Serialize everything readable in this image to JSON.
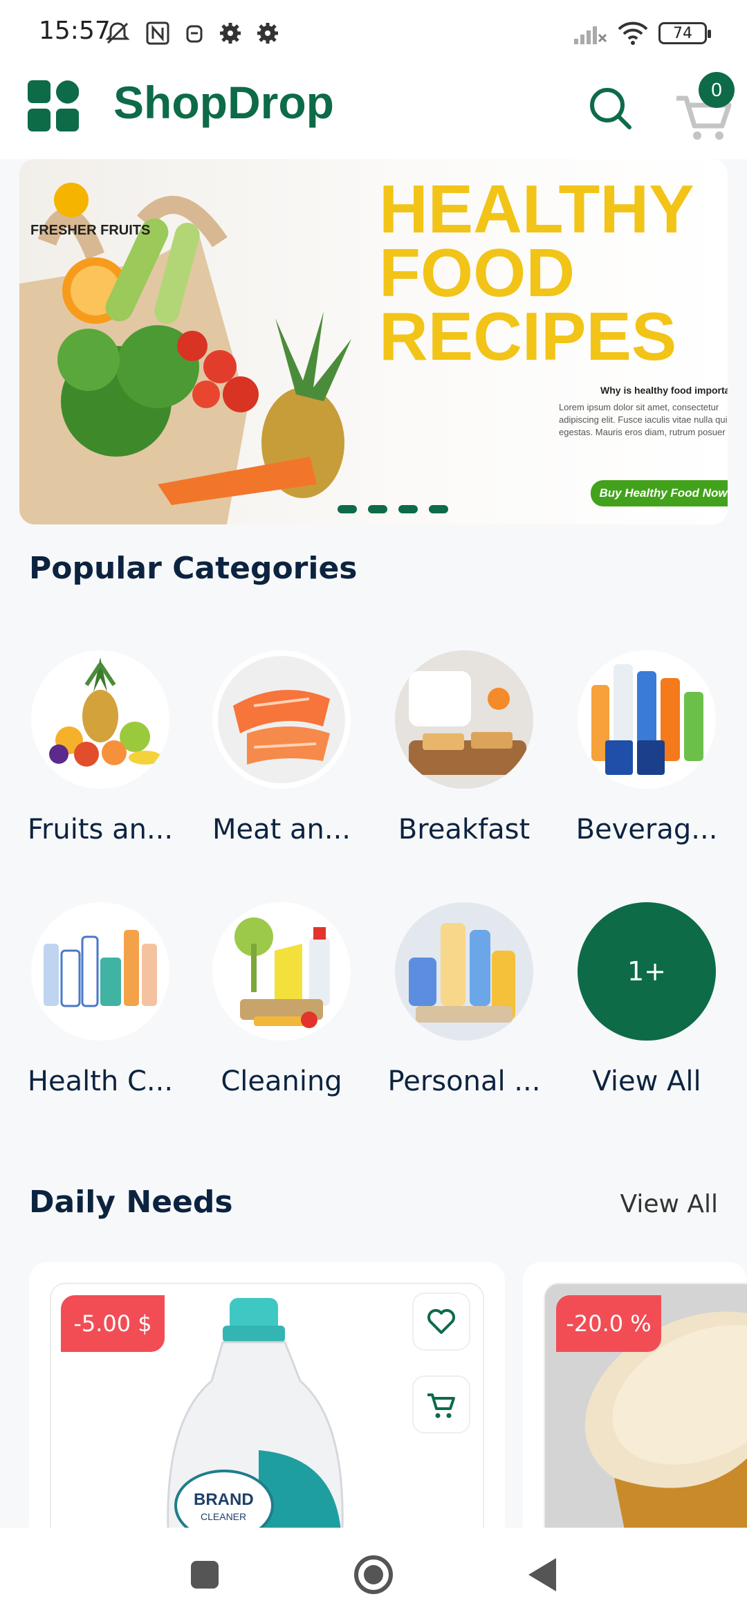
{
  "status_bar": {
    "time": "15:57",
    "battery": "74"
  },
  "app_bar": {
    "title": "ShopDrop",
    "cart_count": "0"
  },
  "banner": {
    "brand": "FRESHER FRUITS",
    "headline": "HEALTHY FOOD RECIPES",
    "sub_title": "Why is healthy food important",
    "sub_body": "Lorem ipsum dolor sit amet, consectetur adipiscing elit. Fusce iaculis vitae nulla qui egestas. Mauris eros diam, rutrum posuer",
    "cta": "Buy Healthy Food Now",
    "slide_count": 4
  },
  "categories": {
    "title": "Popular Categories",
    "items": [
      {
        "label": "Fruits an..."
      },
      {
        "label": "Meat an..."
      },
      {
        "label": "Breakfast"
      },
      {
        "label": "Beverag..."
      },
      {
        "label": "Health C..."
      },
      {
        "label": "Cleaning"
      },
      {
        "label": "Personal ..."
      },
      {
        "label": "View All",
        "badge": "1+"
      }
    ]
  },
  "daily_needs": {
    "title": "Daily Needs",
    "view_all": "View All",
    "products": [
      {
        "discount": "-5.00 $",
        "brand_text": "BRAND",
        "brand_sub": "CLEANER"
      },
      {
        "discount": "-20.0 %"
      }
    ]
  },
  "colors": {
    "primary": "#0d6b48",
    "discount": "#f24d55",
    "headline": "#f2c417",
    "text": "#0c2340"
  }
}
